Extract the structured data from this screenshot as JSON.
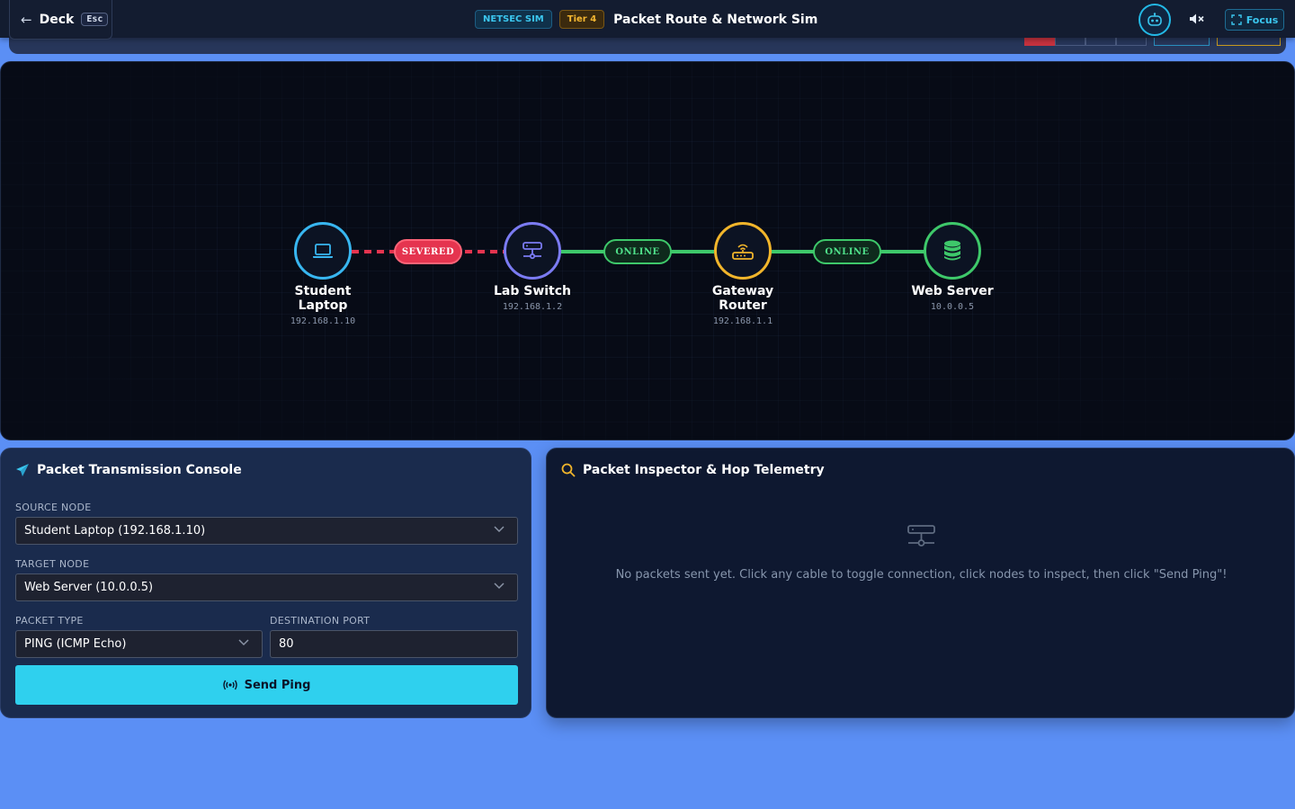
{
  "header": {
    "back_label": "Deck",
    "back_key": "Esc",
    "badge_module": "NETSEC SIM",
    "badge_tier": "Tier 4",
    "title": "Packet Route & Network Sim",
    "focus_label": "Focus",
    "accent": "#3bc7ef"
  },
  "network": {
    "nodes": [
      {
        "name": "Student Laptop",
        "ip": "192.168.1.10",
        "icon": "laptop-icon",
        "color": "#38b6f0"
      },
      {
        "name": "Lab Switch",
        "ip": "192.168.1.2",
        "icon": "switch-icon",
        "color": "#7b7bf2"
      },
      {
        "name": "Gateway Router",
        "ip": "192.168.1.1",
        "icon": "router-icon",
        "color": "#f1b52b"
      },
      {
        "name": "Web Server",
        "ip": "10.0.0.5",
        "icon": "database-icon",
        "color": "#3ec86a"
      }
    ],
    "links": [
      {
        "status": "SEVERED",
        "color": "#e5344f"
      },
      {
        "status": "ONLINE",
        "color": "#3ec86a"
      },
      {
        "status": "ONLINE",
        "color": "#3ec86a"
      }
    ]
  },
  "console": {
    "title": "Packet Transmission Console",
    "source_label": "SOURCE NODE",
    "source_value": "Student Laptop (192.168.1.10)",
    "target_label": "TARGET NODE",
    "target_value": "Web Server (10.0.0.5)",
    "type_label": "PACKET TYPE",
    "type_value": "PING (ICMP Echo)",
    "port_label": "DESTINATION PORT",
    "port_value": "80",
    "send_label": "Send Ping"
  },
  "inspector": {
    "title": "Packet Inspector & Hop Telemetry",
    "empty_message": "No packets sent yet. Click any cable to toggle connection, click nodes to inspect, then click \"Send Ping\"!"
  }
}
